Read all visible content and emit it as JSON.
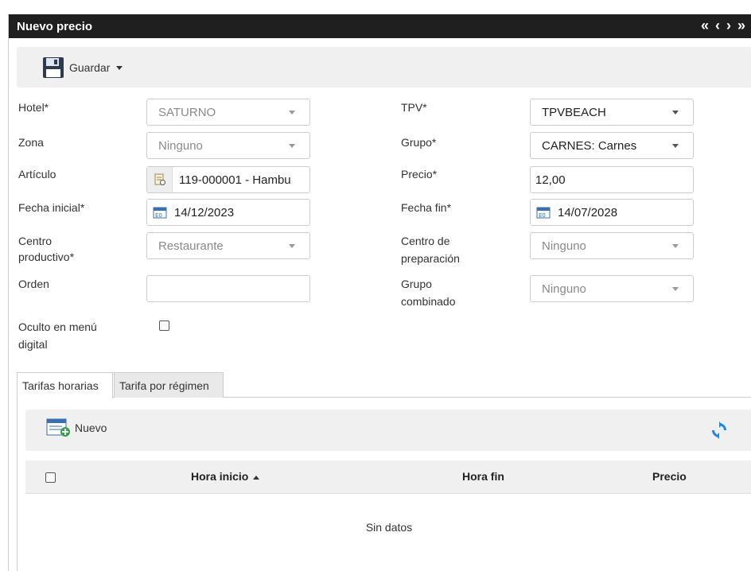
{
  "window": {
    "title": "Nuevo precio"
  },
  "nav": {
    "first": "«",
    "prev": "‹",
    "next": "›",
    "last": "»"
  },
  "toolbar": {
    "save_label": "Guardar"
  },
  "form": {
    "hotel": {
      "label": "Hotel*",
      "value": "SATURNO"
    },
    "zona": {
      "label": "Zona",
      "value": "Ninguno"
    },
    "articulo": {
      "label": "Artículo",
      "value": "119-000001 - Hambu"
    },
    "fecha_inicial": {
      "label": "Fecha inicial*",
      "value": "14/12/2023"
    },
    "centro_productivo": {
      "label_1": "Centro",
      "label_2": "productivo*",
      "value": "Restaurante"
    },
    "orden": {
      "label": "Orden",
      "value": ""
    },
    "oculto": {
      "label_1": "Oculto en menú",
      "label_2": "digital",
      "checked": false
    },
    "tpv": {
      "label": "TPV*",
      "value": "TPVBEACH"
    },
    "grupo": {
      "label": "Grupo*",
      "value": "CARNES: Carnes"
    },
    "precio": {
      "label": "Precio*",
      "value": "12,00"
    },
    "fecha_fin": {
      "label": "Fecha fin*",
      "value": "14/07/2028"
    },
    "centro_preparacion": {
      "label_1": "Centro de",
      "label_2": "preparación",
      "value": "Ninguno"
    },
    "grupo_combinado": {
      "label_1": "Grupo",
      "label_2": "combinado",
      "value": "Ninguno"
    }
  },
  "tabs": [
    {
      "label": "Tarifas horarias",
      "active": true
    },
    {
      "label": "Tarifa por régimen",
      "active": false
    }
  ],
  "grid": {
    "new_label": "Nuevo",
    "columns": [
      "Hora inicio",
      "Hora fin",
      "Precio"
    ],
    "empty_text": "Sin datos"
  },
  "colors": {
    "titlebar": "#1f1f1f",
    "toolbar": "#f0f0f0",
    "accent_blue": "#1e88e5"
  }
}
